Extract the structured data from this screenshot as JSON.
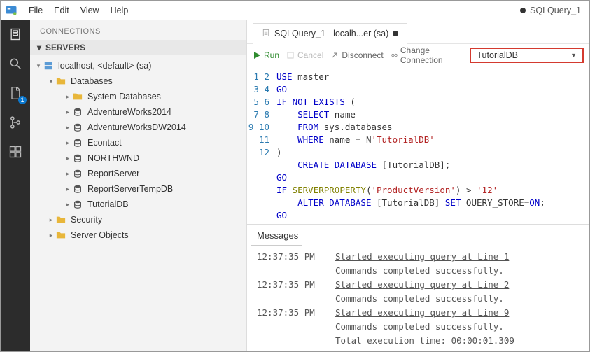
{
  "menubar": {
    "items": [
      "File",
      "Edit",
      "View",
      "Help"
    ],
    "window_title": "SQLQuery_1"
  },
  "activitybar": {
    "items": [
      {
        "name": "servers-icon"
      },
      {
        "name": "search-icon"
      },
      {
        "name": "file-icon",
        "badge": "1"
      },
      {
        "name": "source-control-icon"
      },
      {
        "name": "extensions-icon"
      }
    ]
  },
  "sidepanel": {
    "title": "CONNECTIONS",
    "section_label": "SERVERS",
    "tree": {
      "server": "localhost, <default> (sa)",
      "databases_label": "Databases",
      "db_children": [
        {
          "label": "System Databases",
          "type": "folder"
        },
        {
          "label": "AdventureWorks2014",
          "type": "db"
        },
        {
          "label": "AdventureWorksDW2014",
          "type": "db"
        },
        {
          "label": "Econtact",
          "type": "db"
        },
        {
          "label": "NORTHWND",
          "type": "db"
        },
        {
          "label": "ReportServer",
          "type": "db"
        },
        {
          "label": "ReportServerTempDB",
          "type": "db"
        },
        {
          "label": "TutorialDB",
          "type": "db"
        }
      ],
      "security_label": "Security",
      "server_objects_label": "Server Objects"
    }
  },
  "editor": {
    "tab_label": "SQLQuery_1 - localh...er (sa)",
    "toolbar": {
      "run": "Run",
      "cancel": "Cancel",
      "disconnect": "Disconnect",
      "change_conn": "Change Connection",
      "db_selected": "TutorialDB"
    },
    "code_lines": [
      1,
      2,
      3,
      4,
      5,
      6,
      7,
      8,
      9,
      10,
      11,
      12
    ],
    "code": {
      "l1": {
        "a": "USE",
        "b": " master"
      },
      "l2": "GO",
      "l3": {
        "a": "IF",
        "b": " NOT",
        "c": " EXISTS",
        "d": " ("
      },
      "l4": {
        "a": "    SELECT",
        "b": " name"
      },
      "l5": {
        "a": "    FROM",
        "b": " sys.databases"
      },
      "l6": {
        "a": "    WHERE",
        "b": " name = N",
        "c": "'TutorialDB'"
      },
      "l7": ")",
      "l8": {
        "a": "    CREATE",
        "b": " DATABASE",
        "c": " [TutorialDB];"
      },
      "l9": "GO",
      "l10": {
        "a": "IF",
        "b": " SERVERPROPERTY",
        "c": "(",
        "d": "'ProductVersion'",
        "e": ") > ",
        "f": "'12'"
      },
      "l11": {
        "a": "    ALTER",
        "b": " DATABASE",
        "c": " [TutorialDB] ",
        "d": "SET",
        "e": " QUERY_STORE=",
        "f": "ON",
        ";": ";"
      },
      "l12": "GO"
    }
  },
  "messages": {
    "title": "Messages",
    "rows": [
      {
        "ts": "12:37:35 PM",
        "txt": "Started executing query at Line 1",
        "u": true
      },
      {
        "ts": "",
        "txt": "Commands completed successfully.",
        "u": false
      },
      {
        "ts": "12:37:35 PM",
        "txt": "Started executing query at Line 2",
        "u": true
      },
      {
        "ts": "",
        "txt": "Commands completed successfully.",
        "u": false
      },
      {
        "ts": "12:37:35 PM",
        "txt": "Started executing query at Line 9",
        "u": true
      },
      {
        "ts": "",
        "txt": "Commands completed successfully.",
        "u": false
      },
      {
        "ts": "",
        "txt": "Total execution time: 00:00:01.309",
        "u": false
      }
    ]
  }
}
